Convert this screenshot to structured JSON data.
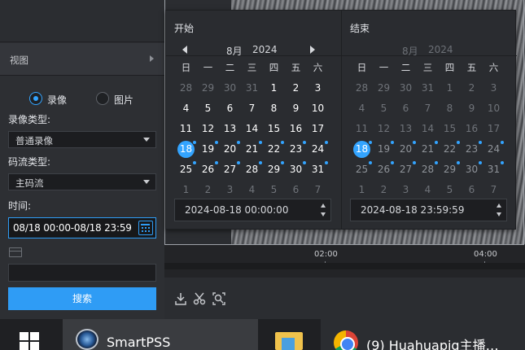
{
  "left_panel": {
    "view_label": "视图",
    "record_type_options": {
      "video": "录像",
      "picture": "图片",
      "selected": "录像"
    },
    "record_type_label": "录像类型:",
    "record_type_value": "普通录像",
    "stream_type_label": "码流类型:",
    "stream_type_value": "主码流",
    "time_label": "时间:",
    "time_value": "08/18 00:00-08/18 23:59",
    "search_button": "搜索"
  },
  "timeline": {
    "labels": [
      "02:00",
      "04:00"
    ]
  },
  "calendar": {
    "weekdays": [
      "日",
      "一",
      "二",
      "三",
      "四",
      "五",
      "六"
    ],
    "start": {
      "title": "开始",
      "month": "8月",
      "year": "2024",
      "time_value": "2024-08-18 00:00:00"
    },
    "end": {
      "title": "结束",
      "month": "8月",
      "year": "2024",
      "time_value": "2024-08-18 23:59:59"
    },
    "weeks": [
      [
        28,
        29,
        30,
        31,
        1,
        2,
        3
      ],
      [
        4,
        5,
        6,
        7,
        8,
        9,
        10
      ],
      [
        11,
        12,
        13,
        14,
        15,
        16,
        17
      ],
      [
        18,
        19,
        20,
        21,
        22,
        23,
        24
      ],
      [
        25,
        26,
        27,
        28,
        29,
        30,
        31
      ],
      [
        1,
        2,
        3,
        4,
        5,
        6,
        7
      ]
    ],
    "selected_day": 18,
    "recorded_days": [
      18,
      19,
      20,
      21,
      22,
      23,
      24,
      25,
      26,
      27,
      28,
      29,
      30,
      31
    ]
  },
  "taskbar": {
    "smartpss_title": "SmartPSS",
    "chrome_title": "(9) Huahuapig主播…"
  },
  "colors": {
    "accent": "#33a4ff",
    "search_button": "#2f9cf5"
  }
}
